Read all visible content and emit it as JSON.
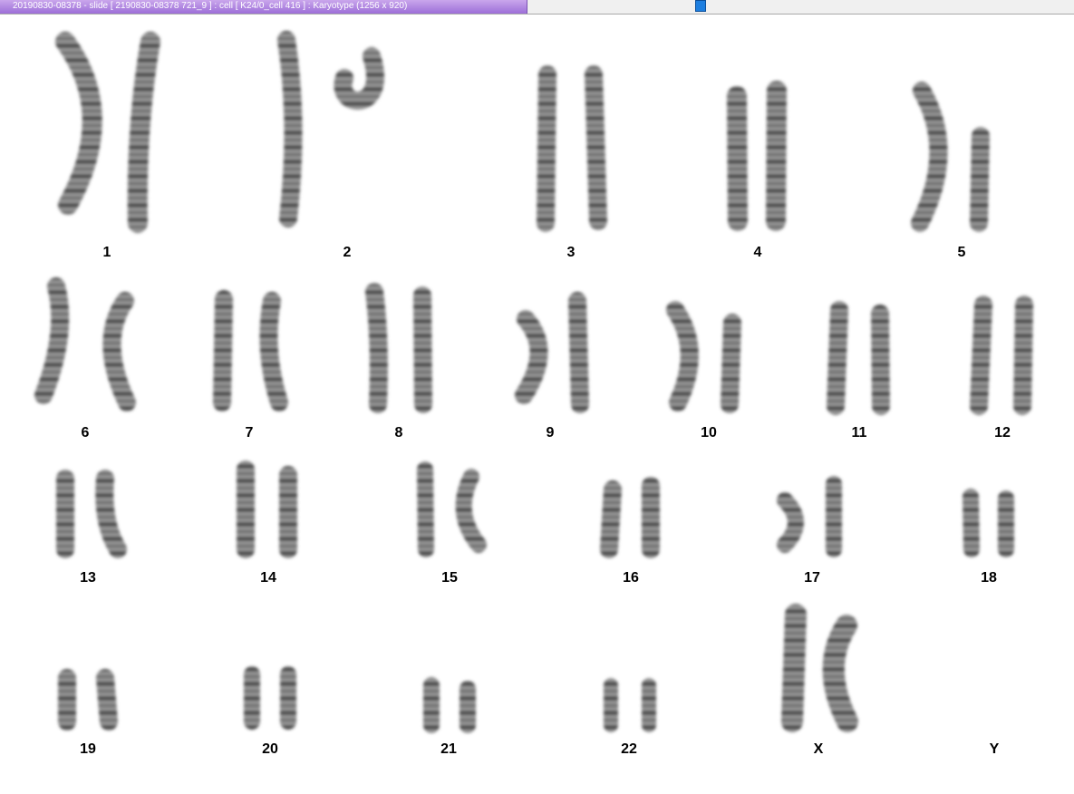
{
  "window": {
    "title": "20190830-08378 - slide [ 2190830-08378 721_9 ] : cell [ K24/0_cell 416 ] : Karyotype  (1256 x 920)",
    "accent": "#a77ee0",
    "handle_color": "#1e7fe0"
  },
  "karyotype": {
    "labels": [
      "1",
      "2",
      "3",
      "4",
      "5",
      "6",
      "7",
      "8",
      "9",
      "10",
      "11",
      "12",
      "13",
      "14",
      "15",
      "16",
      "17",
      "18",
      "19",
      "20",
      "21",
      "22",
      "X",
      "Y"
    ]
  }
}
